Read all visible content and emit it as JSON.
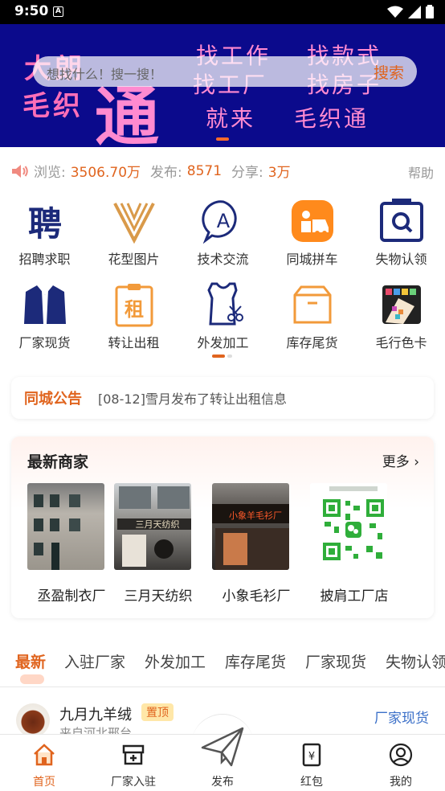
{
  "status_bar": {
    "time": "9:50",
    "sim_label": "A"
  },
  "search": {
    "placeholder": "想找什么！搜一搜！",
    "button": "搜索"
  },
  "banner": {
    "brand_line1": "大朗",
    "brand_line2": "毛织",
    "big_char": "通",
    "tag_find_job": "找工作",
    "tag_find_style": "找款式",
    "tag_find_factory": "找工厂",
    "tag_find_house": "找房子",
    "tag_come": "就来",
    "tag_app": "毛织通"
  },
  "stats": {
    "views_label": "浏览:",
    "views_value": "3506.70万",
    "posts_label": "发布:",
    "posts_value": "8571",
    "shares_label": "分享:",
    "shares_value": "3万",
    "help": "帮助"
  },
  "categories": [
    {
      "label": "招聘求职",
      "icon": "recruit-icon"
    },
    {
      "label": "花型图片",
      "icon": "pattern-icon"
    },
    {
      "label": "技术交流",
      "icon": "tech-exchange-icon"
    },
    {
      "label": "同城拼车",
      "icon": "carpool-icon"
    },
    {
      "label": "失物认领",
      "icon": "lost-found-icon"
    },
    {
      "label": "厂家现货",
      "icon": "suit-icon"
    },
    {
      "label": "转让出租",
      "icon": "rent-icon"
    },
    {
      "label": "外发加工",
      "icon": "sewing-icon"
    },
    {
      "label": "库存尾货",
      "icon": "box-icon"
    },
    {
      "label": "毛行色卡",
      "icon": "color-card-icon"
    }
  ],
  "notice": {
    "title": "同城公告",
    "message": "[08-12]雪月发布了转让出租信息"
  },
  "merchants": {
    "title": "最新商家",
    "more": "更多",
    "items": [
      {
        "name": "丞盈制衣厂"
      },
      {
        "name": "三月天纺织"
      },
      {
        "name": "小象毛衫厂"
      },
      {
        "name": "披肩工厂店"
      }
    ],
    "sign_text": "三月天纺织",
    "sign_text_2": "小象羊毛衫厂"
  },
  "tabs": [
    "最新",
    "入驻厂家",
    "外发加工",
    "库存尾货",
    "厂家现货",
    "失物认领"
  ],
  "post": {
    "name": "九月九羊绒",
    "pin": "置顶",
    "source": "来自河北邢台",
    "category": "厂家现货"
  },
  "bottom_nav": [
    {
      "label": "首页",
      "active": true
    },
    {
      "label": "厂家入驻"
    },
    {
      "label": "发布"
    },
    {
      "label": "红包"
    },
    {
      "label": "我的"
    }
  ],
  "colors": {
    "accent": "#e0641e",
    "banner_bg": "#0b0a8c",
    "banner_text": "#ff8ad0",
    "navy_icon": "#1c2a7a",
    "link_blue": "#3a6fc8"
  }
}
